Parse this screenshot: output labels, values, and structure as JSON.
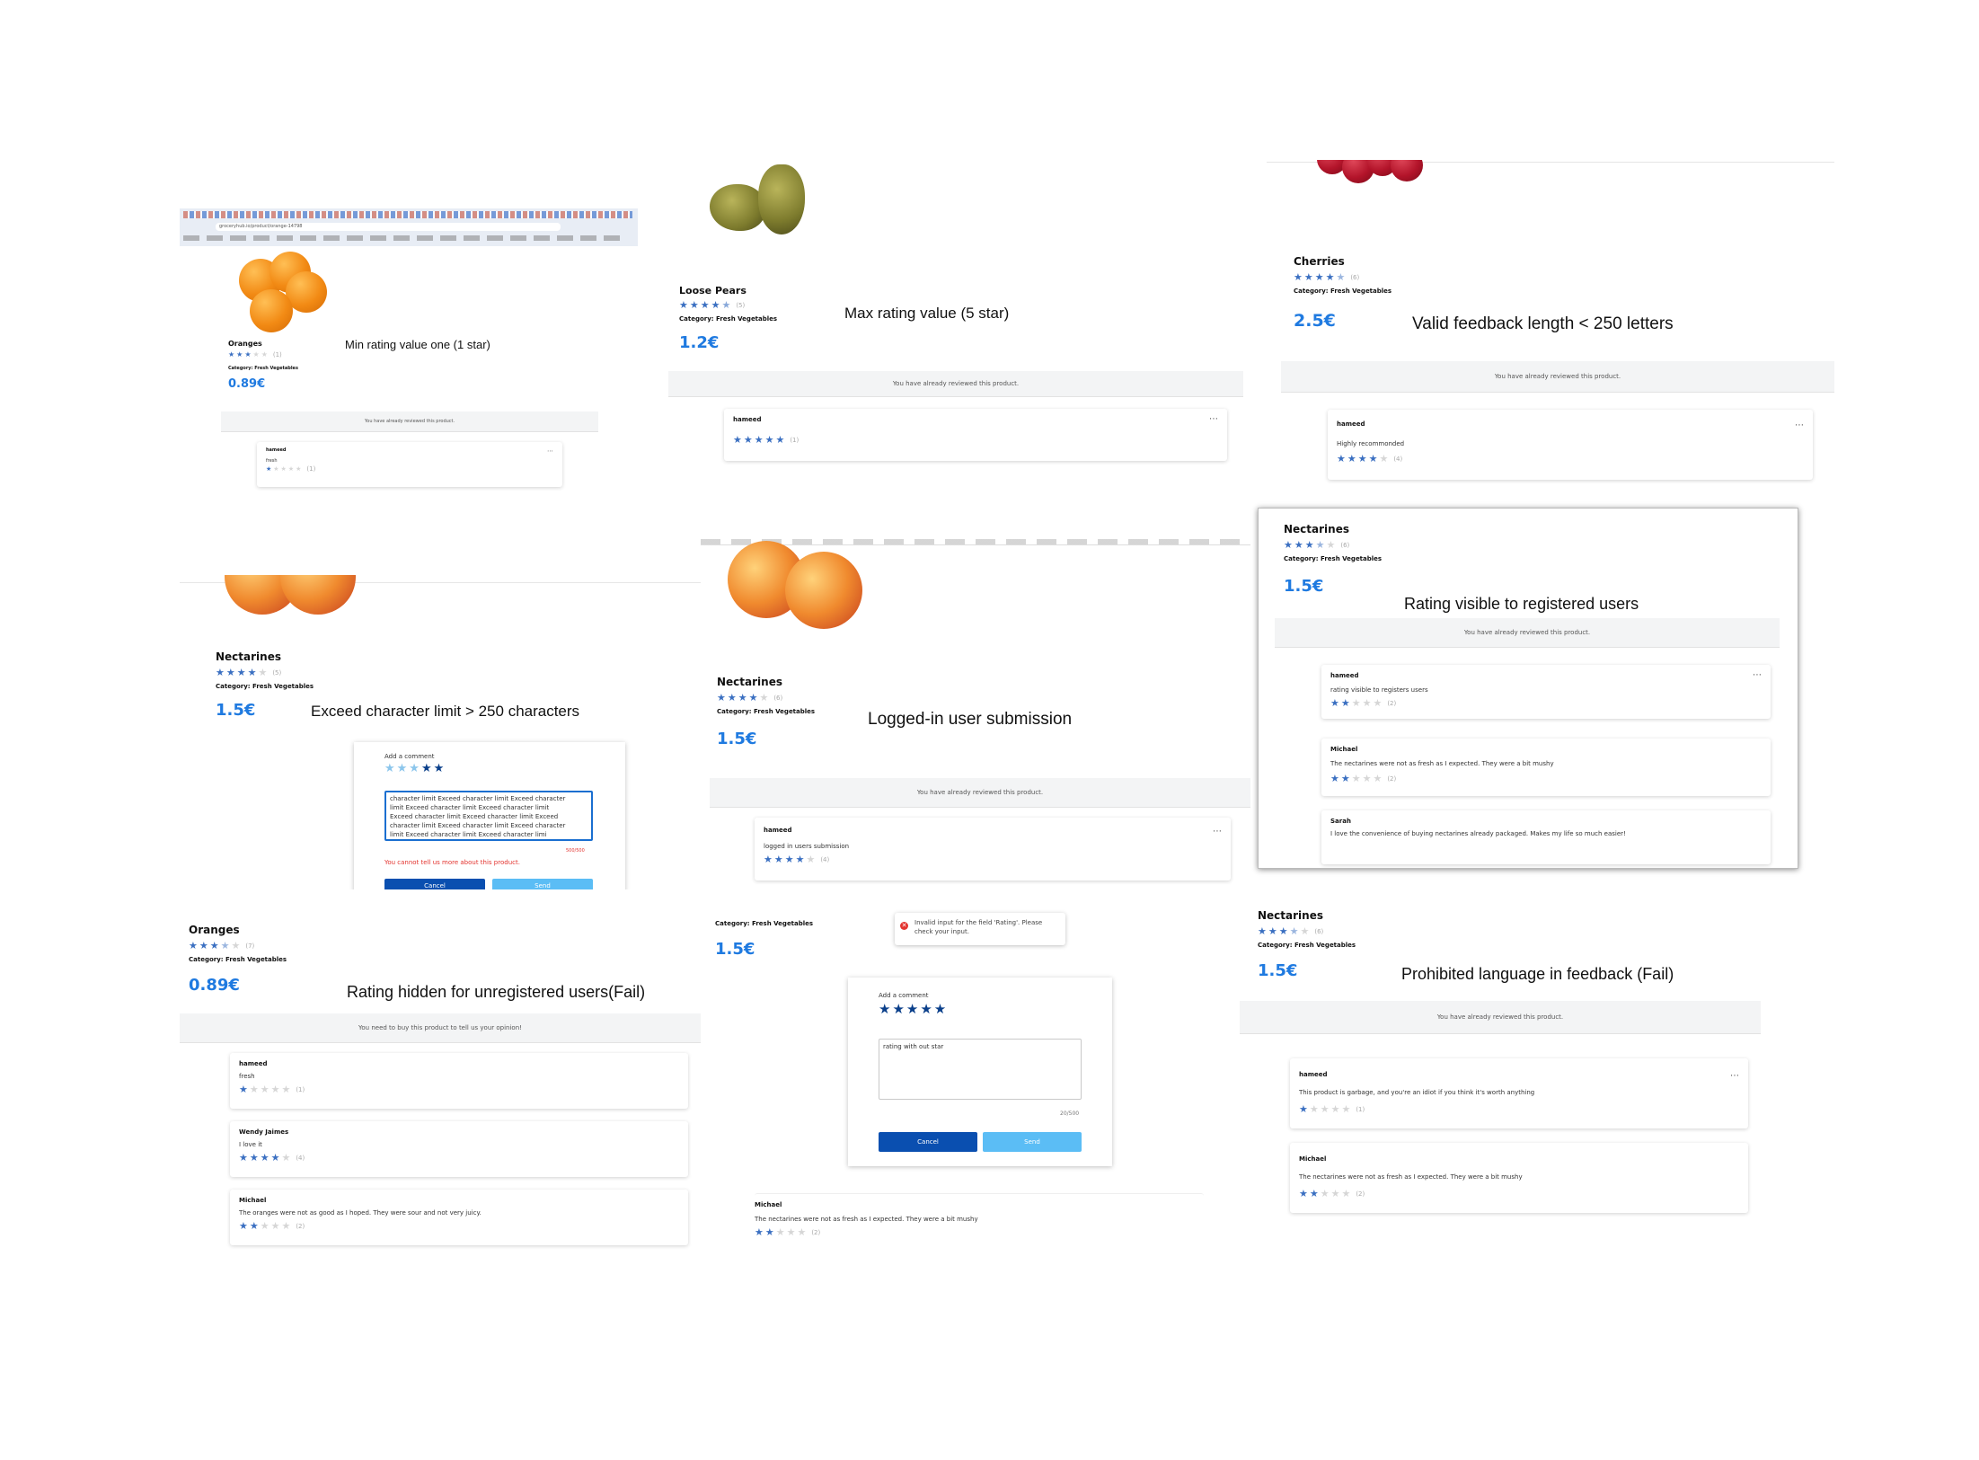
{
  "panels": {
    "p1": {
      "browser_url": "groceryhub.io/product/orange-14798",
      "product": "Oranges",
      "count": "(1)",
      "category": "Category: Fresh Vegetables",
      "price": "0.89€",
      "caption": "Min rating  value one (1 star)",
      "banner": "You have already reviewed this product.",
      "review": {
        "user": "hameed",
        "text": "fresh",
        "count": "(1)"
      }
    },
    "p2": {
      "product": "Loose Pears",
      "count": "(5)",
      "category": "Category: Fresh Vegetables",
      "price": "1.2€",
      "caption": "Max rating value (5 star)",
      "banner": "You have already reviewed this product.",
      "review": {
        "user": "hameed",
        "count": "(1)"
      }
    },
    "p3": {
      "product": "Cherries",
      "count": "(6)",
      "category": "Category: Fresh Vegetables",
      "price": "2.5€",
      "caption": "Valid feedback length < 250 letters",
      "banner": "You have already reviewed this product.",
      "review": {
        "user": "hameed",
        "text": "Highly recommonded",
        "count": "(4)"
      }
    },
    "p4": {
      "product": "Nectarines",
      "count": "(5)",
      "category": "Category: Fresh Vegetables",
      "price": "1.5€",
      "caption": "Exceed character limit  > 250 characters",
      "comment_label": "Add a comment",
      "textarea_lines": [
        "character limit  Exceed character limit  Exceed character",
        "limit  Exceed character limit  Exceed character limit",
        "Exceed character limit  Exceed character limit  Exceed",
        "character limit  Exceed character limit  Exceed character",
        "limit  Exceed character limit  Exceed character limi"
      ],
      "counter": "500/500",
      "error": "You cannot tell us more about this product.",
      "cancel": "Cancel",
      "send": "Send"
    },
    "p5": {
      "product": "Nectarines",
      "count": "(6)",
      "category": "Category: Fresh Vegetables",
      "price": "1.5€",
      "caption": "Logged-in user submission",
      "banner": "You have already reviewed this product.",
      "review": {
        "user": "hameed",
        "text": "logged in users submission",
        "count": "(4)"
      }
    },
    "p6": {
      "product": "Nectarines",
      "count": "(6)",
      "category": "Category: Fresh Vegetables",
      "price": "1.5€",
      "caption": "Rating visible to registered users",
      "banner": "You have already reviewed this product.",
      "reviews": [
        {
          "user": "hameed",
          "text": "rating visible to registers users",
          "count": "(2)"
        },
        {
          "user": "Michael",
          "text": "The nectarines were not as fresh as I expected. They were a bit mushy",
          "count": "(2)"
        },
        {
          "user": "Sarah",
          "text": "I love the convenience of buying nectarines already packaged. Makes my life so much easier!"
        }
      ]
    },
    "p7": {
      "product": "Oranges",
      "count": "(7)",
      "category": "Category: Fresh Vegetables",
      "price": "0.89€",
      "caption": "Rating hidden for unregistered users(Fail)",
      "banner": "You need to buy this product to tell us your opinion!",
      "reviews": [
        {
          "user": "hameed",
          "text": "fresh",
          "count": "(1)"
        },
        {
          "user": "Wendy Jaimes",
          "text": "I love it",
          "count": "(4)"
        },
        {
          "user": "Michael",
          "text": "The oranges were not as good as I hoped. They were sour and not very juicy.",
          "count": "(2)"
        }
      ]
    },
    "p8": {
      "category": "Category: Fresh Vegetables",
      "price": "1.5€",
      "toast": "Invalid input for the field 'Rating'. Please check your input.",
      "comment_label": "Add a comment",
      "textarea": "rating with out star",
      "counter": "20/500",
      "cancel": "Cancel",
      "send": "Send",
      "review": {
        "user": "Michael",
        "text": "The nectarines were not as fresh as I expected. They were a bit mushy",
        "count": "(2)"
      }
    },
    "p9": {
      "product": "Nectarines",
      "count": "(6)",
      "category": "Category: Fresh Vegetables",
      "price": "1.5€",
      "caption": "Prohibited language in feedback (Fail)",
      "banner": "You have already reviewed this product.",
      "reviews": [
        {
          "user": "hameed",
          "text": "This product is garbage, and you're an idiot if you think it's worth anything",
          "count": "(1)"
        },
        {
          "user": "Michael",
          "text": "The nectarines were not as fresh as I expected. They were a bit mushy",
          "count": "(2)"
        }
      ]
    }
  },
  "colors": {
    "price": "#1f7ae0",
    "star": "#3a6fc1",
    "cancel": "#0a4fb0",
    "send": "#5bbdf5",
    "error": "#e3342f"
  }
}
